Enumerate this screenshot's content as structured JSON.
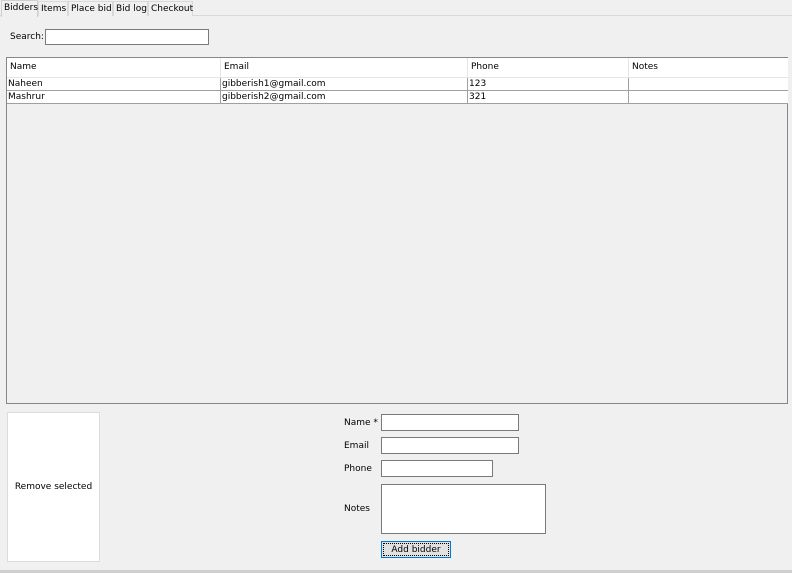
{
  "tabs": [
    {
      "label": "Bidders",
      "active": true
    },
    {
      "label": "Items",
      "active": false
    },
    {
      "label": "Place bid",
      "active": false
    },
    {
      "label": "Bid log",
      "active": false
    },
    {
      "label": "Checkout",
      "active": false
    }
  ],
  "search": {
    "label": "Search:",
    "value": ""
  },
  "table": {
    "columns": [
      "Name",
      "Email",
      "Phone",
      "Notes"
    ],
    "rows": [
      {
        "name": "Naheen",
        "email": "gibberish1@gmail.com",
        "phone": "123",
        "notes": ""
      },
      {
        "name": "Mashrur",
        "email": "gibberish2@gmail.com",
        "phone": "321",
        "notes": ""
      }
    ]
  },
  "actions": {
    "remove_label": "Remove selected",
    "add_label": "Add bidder"
  },
  "form": {
    "name_label": "Name *",
    "email_label": "Email",
    "phone_label": "Phone",
    "notes_label": "Notes",
    "name_value": "",
    "email_value": "",
    "phone_value": "",
    "notes_value": ""
  },
  "colors": {
    "window_bg": "#f0f0f0",
    "focus_border": "#0078d7"
  }
}
